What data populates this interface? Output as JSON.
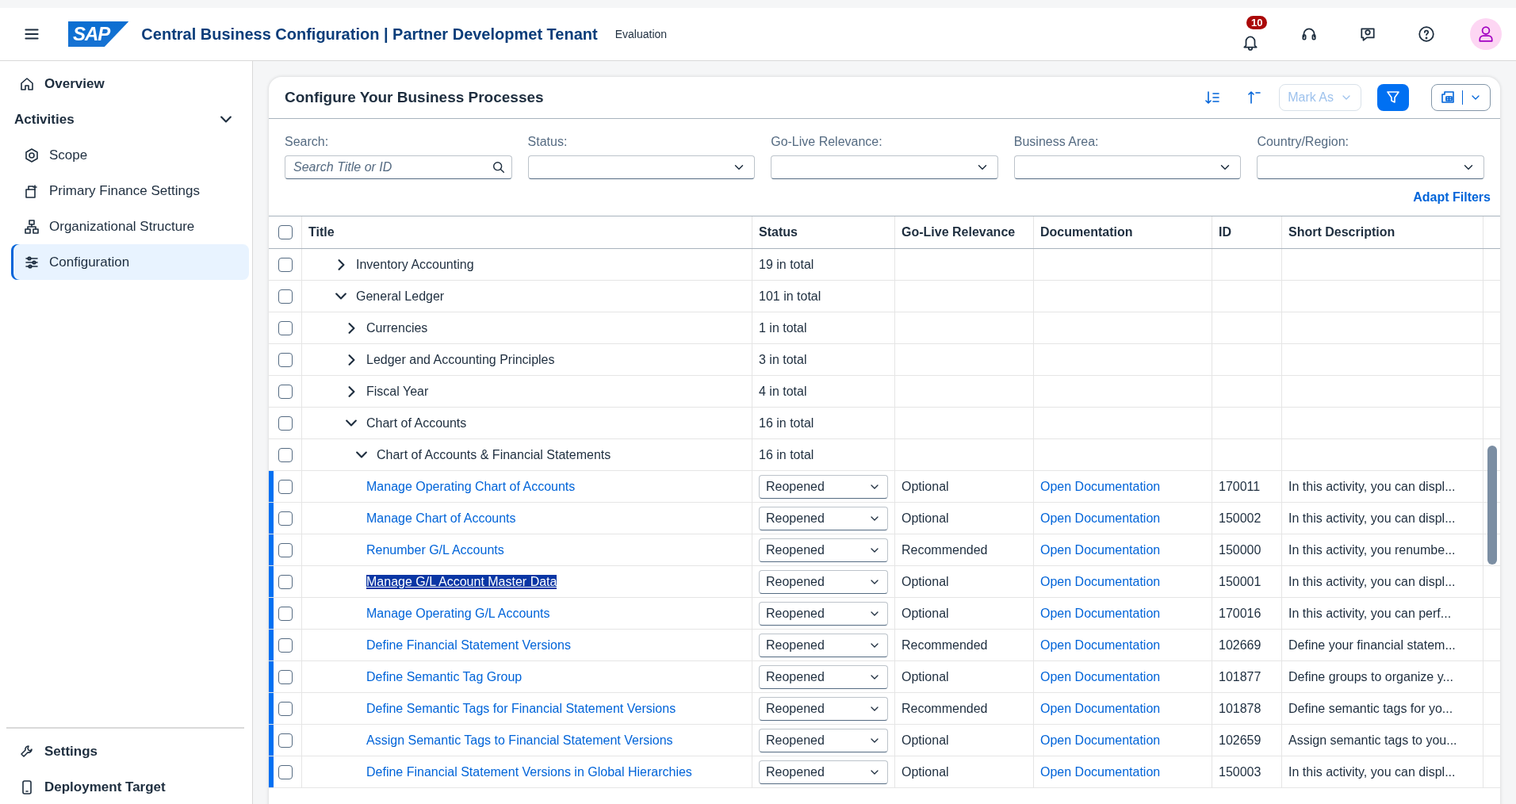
{
  "shell_bar": {
    "logo": "SAP",
    "title": "Central Business Configuration | Partner Developmet Tenant",
    "subtitle": "Evaluation",
    "notifications_badge": "10"
  },
  "sidebar": {
    "items": [
      {
        "label": "Overview",
        "kind": "top",
        "selected": false
      },
      {
        "label": "Activities",
        "kind": "group",
        "expanded": true,
        "selected": false
      },
      {
        "label": "Scope",
        "kind": "sub",
        "selected": false
      },
      {
        "label": "Primary Finance Settings",
        "kind": "sub",
        "selected": false
      },
      {
        "label": "Organizational Structure",
        "kind": "sub",
        "selected": false
      },
      {
        "label": "Configuration",
        "kind": "sub",
        "selected": true
      }
    ],
    "footer_items": [
      {
        "label": "Settings"
      },
      {
        "label": "Deployment Target"
      }
    ]
  },
  "card": {
    "title": "Configure Your Business Processes",
    "mark_as": {
      "label": "Mark As",
      "disabled": true
    },
    "filter_active": true,
    "filters": [
      {
        "label": "Search:",
        "kind": "search",
        "placeholder": "Search Title or ID"
      },
      {
        "label": "Status:",
        "kind": "select"
      },
      {
        "label": "Go-Live Relevance:",
        "kind": "select"
      },
      {
        "label": "Business Area:",
        "kind": "select"
      },
      {
        "label": "Country/Region:",
        "kind": "select"
      }
    ],
    "adapt_filters": "Adapt Filters",
    "table": {
      "select_all_checked": false,
      "columns": [
        "Title",
        "Status",
        "Go-Live Relevance",
        "Documentation",
        "ID",
        "Short Description"
      ],
      "rows": [
        {
          "kind": "group",
          "title": "Inventory Accounting",
          "total": "19 in total",
          "expanded": false,
          "checked": false
        },
        {
          "kind": "group",
          "title": "General Ledger",
          "total": "101 in total",
          "expanded": true,
          "checked": false,
          "children": [
            {
              "kind": "group",
              "title": "Currencies",
              "total": "1 in total",
              "expanded": false,
              "checked": false
            },
            {
              "kind": "group",
              "title": "Ledger and Accounting Principles",
              "total": "3 in total",
              "expanded": false,
              "checked": false
            },
            {
              "kind": "group",
              "title": "Fiscal Year",
              "total": "4 in total",
              "expanded": false,
              "checked": false
            },
            {
              "kind": "group",
              "title": "Chart of Accounts",
              "total": "16 in total",
              "expanded": true,
              "checked": false,
              "children": [
                {
                  "kind": "group",
                  "title": "Chart of Accounts & Financial Statements",
                  "total": "16 in total",
                  "expanded": true,
                  "checked": false,
                  "children": [
                    {
                      "kind": "activity",
                      "title": "Manage Operating Chart of Accounts",
                      "status": "Reopened",
                      "relevance": "Optional",
                      "documentation": "Open Documentation",
                      "id": "170011",
                      "description": "In this activity, you can displ...",
                      "checked": false,
                      "text_highlighted": false
                    },
                    {
                      "kind": "activity",
                      "title": "Manage Chart of Accounts",
                      "status": "Reopened",
                      "relevance": "Optional",
                      "documentation": "Open Documentation",
                      "id": "150002",
                      "description": "In this activity, you can displ...",
                      "checked": false,
                      "text_highlighted": false
                    },
                    {
                      "kind": "activity",
                      "title": "Renumber G/L Accounts",
                      "status": "Reopened",
                      "relevance": "Recommended",
                      "documentation": "Open Documentation",
                      "id": "150000",
                      "description": "In this activity, you renumbe...",
                      "checked": false,
                      "text_highlighted": false
                    },
                    {
                      "kind": "activity",
                      "title": "Manage G/L Account Master Data",
                      "status": "Reopened",
                      "relevance": "Optional",
                      "documentation": "Open Documentation",
                      "id": "150001",
                      "description": "In this activity, you can displ...",
                      "checked": false,
                      "text_highlighted": true
                    },
                    {
                      "kind": "activity",
                      "title": "Manage Operating G/L Accounts",
                      "status": "Reopened",
                      "relevance": "Optional",
                      "documentation": "Open Documentation",
                      "id": "170016",
                      "description": "In this activity, you can perf...",
                      "checked": false,
                      "text_highlighted": false
                    },
                    {
                      "kind": "activity",
                      "title": "Define Financial Statement Versions",
                      "status": "Reopened",
                      "relevance": "Recommended",
                      "documentation": "Open Documentation",
                      "id": "102669",
                      "description": "Define your financial statem...",
                      "checked": false,
                      "text_highlighted": false
                    },
                    {
                      "kind": "activity",
                      "title": "Define Semantic Tag Group",
                      "status": "Reopened",
                      "relevance": "Optional",
                      "documentation": "Open Documentation",
                      "id": "101877",
                      "description": "Define groups to organize y...",
                      "checked": false,
                      "text_highlighted": false
                    },
                    {
                      "kind": "activity",
                      "title": "Define Semantic Tags for Financial Statement Versions",
                      "status": "Reopened",
                      "relevance": "Recommended",
                      "documentation": "Open Documentation",
                      "id": "101878",
                      "description": "Define semantic tags for yo...",
                      "checked": false,
                      "text_highlighted": false
                    },
                    {
                      "kind": "activity",
                      "title": "Assign Semantic Tags to Financial Statement Versions",
                      "status": "Reopened",
                      "relevance": "Optional",
                      "documentation": "Open Documentation",
                      "id": "102659",
                      "description": "Assign semantic tags to you...",
                      "checked": false,
                      "text_highlighted": false
                    },
                    {
                      "kind": "activity",
                      "title": "Define Financial Statement Versions in Global Hierarchies",
                      "status": "Reopened",
                      "relevance": "Optional",
                      "documentation": "Open Documentation",
                      "id": "150003",
                      "description": "In this activity, you can displ...",
                      "checked": false,
                      "text_highlighted": false
                    }
                  ]
                }
              ]
            }
          ]
        }
      ]
    }
  }
}
